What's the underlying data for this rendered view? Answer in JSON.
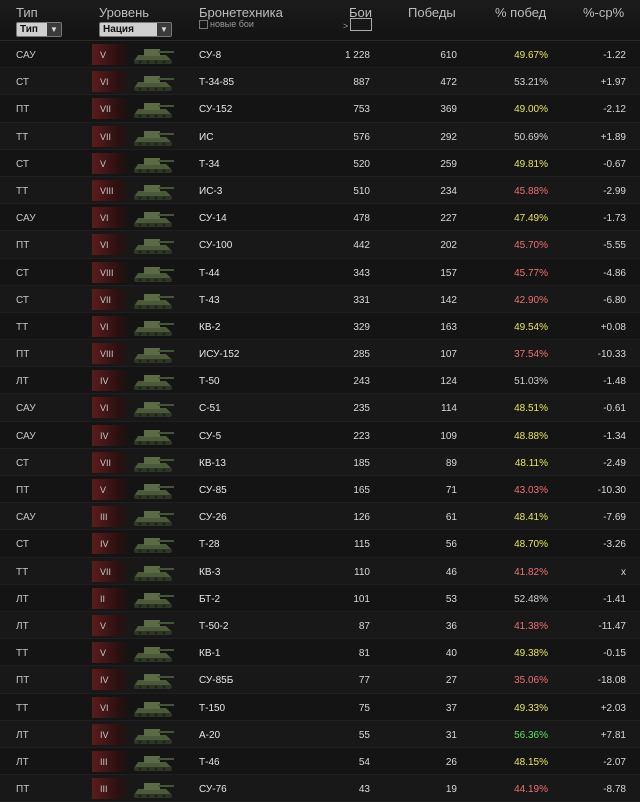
{
  "header": {
    "type_label": "Тип",
    "type_select": "Тип",
    "tier_label": "Уровень",
    "nation_select": "Нация",
    "vehicle_label": "Бронетехника",
    "new_battles_label": "новые бои",
    "battles_label": "Бои",
    "battles_gt": ">",
    "wins_label": "Победы",
    "pct_label": "% побед",
    "diff_label": "%-ср%"
  },
  "colors": {
    "good": "#e6e65a",
    "neutral": "#cfcfcf",
    "bad": "#f07070",
    "great": "#5fe05f"
  },
  "rows": [
    {
      "type": "САУ",
      "tier": "V",
      "name": "СУ-8",
      "battles": "1 228",
      "wins": "610",
      "pct": "49.67%",
      "diff": "-1.22",
      "pc": "good"
    },
    {
      "type": "СТ",
      "tier": "VI",
      "name": "Т-34-85",
      "battles": "887",
      "wins": "472",
      "pct": "53.21%",
      "diff": "+1.97",
      "pc": "neutral"
    },
    {
      "type": "ПТ",
      "tier": "VII",
      "name": "СУ-152",
      "battles": "753",
      "wins": "369",
      "pct": "49.00%",
      "diff": "-2.12",
      "pc": "good"
    },
    {
      "type": "ТТ",
      "tier": "VII",
      "name": "ИС",
      "battles": "576",
      "wins": "292",
      "pct": "50.69%",
      "diff": "+1.89",
      "pc": "neutral"
    },
    {
      "type": "СТ",
      "tier": "V",
      "name": "Т-34",
      "battles": "520",
      "wins": "259",
      "pct": "49.81%",
      "diff": "-0.67",
      "pc": "good"
    },
    {
      "type": "ТТ",
      "tier": "VIII",
      "name": "ИС-3",
      "battles": "510",
      "wins": "234",
      "pct": "45.88%",
      "diff": "-2.99",
      "pc": "bad"
    },
    {
      "type": "САУ",
      "tier": "VI",
      "name": "СУ-14",
      "battles": "478",
      "wins": "227",
      "pct": "47.49%",
      "diff": "-1.73",
      "pc": "good"
    },
    {
      "type": "ПТ",
      "tier": "VI",
      "name": "СУ-100",
      "battles": "442",
      "wins": "202",
      "pct": "45.70%",
      "diff": "-5.55",
      "pc": "bad"
    },
    {
      "type": "СТ",
      "tier": "VIII",
      "name": "Т-44",
      "battles": "343",
      "wins": "157",
      "pct": "45.77%",
      "diff": "-4.86",
      "pc": "bad"
    },
    {
      "type": "СТ",
      "tier": "VII",
      "name": "Т-43",
      "battles": "331",
      "wins": "142",
      "pct": "42.90%",
      "diff": "-6.80",
      "pc": "bad"
    },
    {
      "type": "ТТ",
      "tier": "VI",
      "name": "КВ-2",
      "battles": "329",
      "wins": "163",
      "pct": "49.54%",
      "diff": "+0.08",
      "pc": "good"
    },
    {
      "type": "ПТ",
      "tier": "VIII",
      "name": "ИСУ-152",
      "battles": "285",
      "wins": "107",
      "pct": "37.54%",
      "diff": "-10.33",
      "pc": "bad"
    },
    {
      "type": "ЛТ",
      "tier": "IV",
      "name": "Т-50",
      "battles": "243",
      "wins": "124",
      "pct": "51.03%",
      "diff": "-1.48",
      "pc": "neutral"
    },
    {
      "type": "САУ",
      "tier": "VI",
      "name": "С-51",
      "battles": "235",
      "wins": "114",
      "pct": "48.51%",
      "diff": "-0.61",
      "pc": "good"
    },
    {
      "type": "САУ",
      "tier": "IV",
      "name": "СУ-5",
      "battles": "223",
      "wins": "109",
      "pct": "48.88%",
      "diff": "-1.34",
      "pc": "good"
    },
    {
      "type": "СТ",
      "tier": "VII",
      "name": "КВ-13",
      "battles": "185",
      "wins": "89",
      "pct": "48.11%",
      "diff": "-2.49",
      "pc": "good"
    },
    {
      "type": "ПТ",
      "tier": "V",
      "name": "СУ-85",
      "battles": "165",
      "wins": "71",
      "pct": "43.03%",
      "diff": "-10.30",
      "pc": "bad"
    },
    {
      "type": "САУ",
      "tier": "III",
      "name": "СУ-26",
      "battles": "126",
      "wins": "61",
      "pct": "48.41%",
      "diff": "-7.69",
      "pc": "good"
    },
    {
      "type": "СТ",
      "tier": "IV",
      "name": "Т-28",
      "battles": "115",
      "wins": "56",
      "pct": "48.70%",
      "diff": "-3.26",
      "pc": "good"
    },
    {
      "type": "ТТ",
      "tier": "VII",
      "name": "КВ-3",
      "battles": "110",
      "wins": "46",
      "pct": "41.82%",
      "diff": "x",
      "pc": "bad"
    },
    {
      "type": "ЛТ",
      "tier": "II",
      "name": "БТ-2",
      "battles": "101",
      "wins": "53",
      "pct": "52.48%",
      "diff": "-1.41",
      "pc": "neutral"
    },
    {
      "type": "ЛТ",
      "tier": "V",
      "name": "Т-50-2",
      "battles": "87",
      "wins": "36",
      "pct": "41.38%",
      "diff": "-11.47",
      "pc": "bad"
    },
    {
      "type": "ТТ",
      "tier": "V",
      "name": "КВ-1",
      "battles": "81",
      "wins": "40",
      "pct": "49.38%",
      "diff": "-0.15",
      "pc": "good"
    },
    {
      "type": "ПТ",
      "tier": "IV",
      "name": "СУ-85Б",
      "battles": "77",
      "wins": "27",
      "pct": "35.06%",
      "diff": "-18.08",
      "pc": "bad"
    },
    {
      "type": "ТТ",
      "tier": "VI",
      "name": "Т-150",
      "battles": "75",
      "wins": "37",
      "pct": "49.33%",
      "diff": "+2.03",
      "pc": "good"
    },
    {
      "type": "ЛТ",
      "tier": "IV",
      "name": "А-20",
      "battles": "55",
      "wins": "31",
      "pct": "56.36%",
      "diff": "+7.81",
      "pc": "great"
    },
    {
      "type": "ЛТ",
      "tier": "III",
      "name": "Т-46",
      "battles": "54",
      "wins": "26",
      "pct": "48.15%",
      "diff": "-2.07",
      "pc": "good"
    },
    {
      "type": "ПТ",
      "tier": "III",
      "name": "СУ-76",
      "battles": "43",
      "wins": "19",
      "pct": "44.19%",
      "diff": "-8.78",
      "pc": "bad"
    }
  ]
}
